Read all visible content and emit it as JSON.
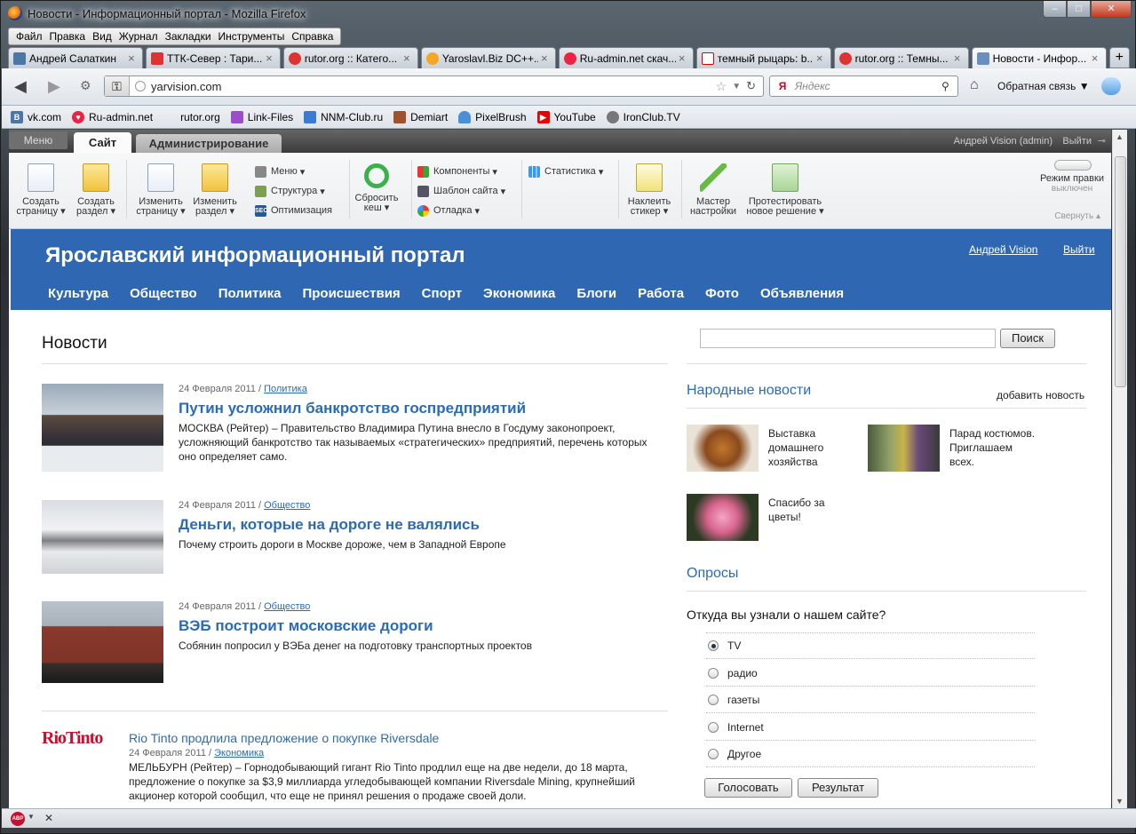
{
  "window": {
    "title": "Новости - Информационный портал - Mozilla Firefox",
    "controls": {
      "minimize": "–",
      "maximize": "□",
      "close": "✕"
    }
  },
  "menubar": [
    "Файл",
    "Правка",
    "Вид",
    "Журнал",
    "Закладки",
    "Инструменты",
    "Справка"
  ],
  "tabs": [
    {
      "label": "Андрей Салаткин",
      "icon_color": "#4a76a8",
      "icon": "vk-icon"
    },
    {
      "label": "ТТК-Север : Тари...",
      "icon_color": "#d33",
      "icon": "ttk-icon"
    },
    {
      "label": "rutor.org :: Катего...",
      "icon_color": "#d33",
      "icon": "rutor-icon"
    },
    {
      "label": "Yaroslavl.Biz DC++...",
      "icon_color": "#f5a623",
      "icon": "yaroslavl-icon"
    },
    {
      "label": "Ru-admin.net скач...",
      "icon_color": "#e24",
      "icon": "heart-icon"
    },
    {
      "label": "темный рыцарь: b...",
      "icon_color": "#d00",
      "icon": "yandex-icon"
    },
    {
      "label": "rutor.org :: Темны...",
      "icon_color": "#d33",
      "icon": "rutor-icon"
    },
    {
      "label": "Новости - Инфор...",
      "icon_color": "#6a8fbf",
      "icon": "page-icon"
    }
  ],
  "navbar": {
    "url": "yarvision.com",
    "search_placeholder": "Яндекс",
    "search_engine": "Я",
    "feedback": "Обратная связь"
  },
  "bookmarks": [
    {
      "label": "vk.com",
      "icon": "vk-icon",
      "color": "#4a76a8",
      "glyph": "B"
    },
    {
      "label": "Ru-admin.net",
      "icon": "heart-icon",
      "color": "#e24",
      "glyph": "♥"
    },
    {
      "label": "rutor.org",
      "icon": "rutor-icon",
      "color": "#d33",
      "glyph": ""
    },
    {
      "label": "Link-Files",
      "icon": "linkfiles-icon",
      "color": "#9b4dca",
      "glyph": ""
    },
    {
      "label": "NNM-Club.ru",
      "icon": "plane-icon",
      "color": "#3a7bd5",
      "glyph": ""
    },
    {
      "label": "Demiart",
      "icon": "demiart-icon",
      "color": "#a0522d",
      "glyph": ""
    },
    {
      "label": "PixelBrush",
      "icon": "pixelbrush-icon",
      "color": "#4a90d9",
      "glyph": ""
    },
    {
      "label": "YouTube",
      "icon": "youtube-icon",
      "color": "#e00",
      "glyph": "▶"
    },
    {
      "label": "IronClub.TV",
      "icon": "ironclub-icon",
      "color": "#777",
      "glyph": ""
    }
  ],
  "admin": {
    "menu": "Меню",
    "tab_site": "Сайт",
    "tab_admin": "Администрирование",
    "user": "Андрей Vision (admin)",
    "logout": "Выйти",
    "tools": {
      "create_page": "Создать странице",
      "create_page_line1": "Создать",
      "create_page_line2": "страницу",
      "create_section_line1": "Создать",
      "create_section_line2": "раздел",
      "edit_page_line1": "Изменить",
      "edit_page_line2": "страницу",
      "edit_section_line1": "Изменить",
      "edit_section_line2": "раздел",
      "menu": "Меню",
      "structure": "Структура",
      "seo": "Оптимизация",
      "reset_line1": "Сбросить",
      "reset_line2": "кеш",
      "components": "Компоненты",
      "template": "Шаблон сайта",
      "debug": "Отладка",
      "stats": "Статистика",
      "sticker_line1": "Наклеить",
      "sticker_line2": "стикер",
      "wizard_line1": "Мастер",
      "wizard_line2": "настройки",
      "test_line1": "Протестировать",
      "test_line2": "новое решение",
      "edit_mode": "Режим правки",
      "edit_mode_state": "выключен",
      "collapse": "Свернуть"
    }
  },
  "site": {
    "title": "Ярославский информационный портал",
    "user_link": "Андрей Vision",
    "logout_link": "Выйти",
    "nav": [
      "Культура",
      "Общество",
      "Политика",
      "Происшествия",
      "Спорт",
      "Экономика",
      "Блоги",
      "Работа",
      "Фото",
      "Объявления"
    ]
  },
  "news": {
    "heading": "Новости",
    "articles": [
      {
        "date": "24 Февраля 2011",
        "category": "Политика",
        "title": "Путин усложнил банкротство госпредприятий",
        "lead": "МОСКВА (Рейтер) – Правительство Владимира Путина внесло в Госдуму законопроект, усложняющий банкротство так называемых «стратегических» предприятий, перечень которых оно определяет само."
      },
      {
        "date": "24 Февраля 2011",
        "category": "Общество",
        "title": "Деньги, которые на дороге не валялись",
        "lead": "Почему строить дороги в Москве дороже, чем в Западной Европе"
      },
      {
        "date": "24 Февраля 2011",
        "category": "Общество",
        "title": "ВЭБ построит московские дороги",
        "lead": "Собянин попросил у ВЭБа денег на подготовку транспортных проектов"
      }
    ],
    "rio": {
      "logo": "RioTinto",
      "title": "Rio Tinto продлила предложение о покупке Riversdale",
      "date": "24 Февраля 2011",
      "category": "Экономика",
      "lead": "МЕЛЬБУРН (Рейтер) – Горнодобывающий гигант Rio Tinto продлил еще на две недели, до 18 марта, предложение о покупке за $3,9 миллиарда угледобывающей компании Riversdale Mining, крупнейший акционер которой сообщил, что еще не принял решения о продаже своей доли."
    }
  },
  "sidebar": {
    "search_button": "Поиск",
    "people_news_title": "Народные новости",
    "add_news": "добавить новость",
    "people_news": [
      {
        "text": "Выставка домашнего хозяйства"
      },
      {
        "text": "Парад костюмов. Приглашаем всех."
      },
      {
        "text": "Спасибо за цветы!"
      }
    ],
    "polls_title": "Опросы",
    "poll_question": "Откуда вы узнали о нашем сайте?",
    "poll_options": [
      "TV",
      "радио",
      "газеты",
      "Internet",
      "Другое"
    ],
    "poll_selected": "TV",
    "vote_button": "Голосовать",
    "result_button": "Результат"
  },
  "statusbar": {
    "close": "✕"
  }
}
